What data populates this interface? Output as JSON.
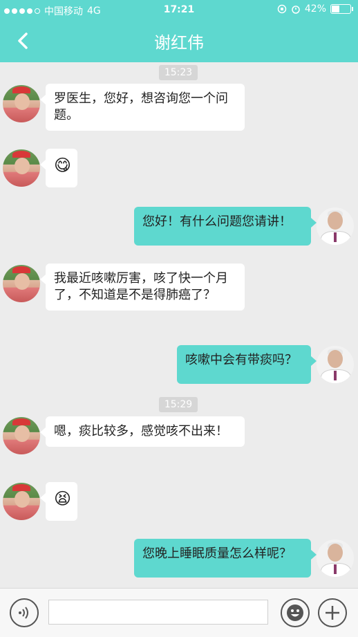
{
  "status_bar": {
    "carrier": "中国移动",
    "network": "4G",
    "time": "17:21",
    "battery_text": "42%",
    "battery_level": 0.42
  },
  "nav": {
    "title": "谢红伟",
    "back_icon": "chevron-left-icon"
  },
  "messages": [
    {
      "type": "time",
      "text": "15:23"
    },
    {
      "type": "incoming",
      "text": "罗医生，您好，想咨询您一个问题。"
    },
    {
      "type": "incoming-emoji",
      "text": "😋"
    },
    {
      "type": "outgoing",
      "text": "您好！有什么问题您请讲！"
    },
    {
      "type": "incoming",
      "text": "我最近咳嗽厉害，咳了快一个月了，不知道是不是得肺癌了？"
    },
    {
      "type": "outgoing",
      "text": "咳嗽中会有带痰吗？"
    },
    {
      "type": "time",
      "text": "15:29"
    },
    {
      "type": "incoming",
      "text": "嗯，痰比较多，感觉咳不出来！"
    },
    {
      "type": "incoming-emoji",
      "text": "😫"
    },
    {
      "type": "outgoing",
      "text": "您晚上睡眠质量怎么样呢？"
    }
  ],
  "input_bar": {
    "voice_icon": "voice-icon",
    "smile_icon": "emoji-icon",
    "plus_icon": "plus-icon",
    "value": ""
  },
  "colors": {
    "accent": "#5ed8cf",
    "background": "#ececec"
  }
}
